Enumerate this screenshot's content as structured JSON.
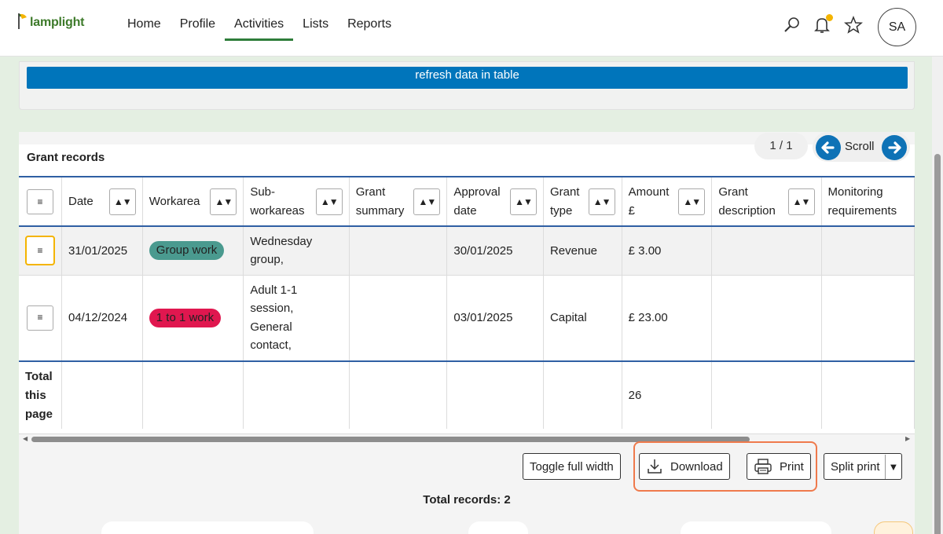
{
  "app": {
    "logo_text": "lamplight"
  },
  "nav": {
    "items": [
      "Home",
      "Profile",
      "Activities",
      "Lists",
      "Reports"
    ],
    "active_index": 2
  },
  "header_icons": [
    "search-icon",
    "bell-icon",
    "star-icon"
  ],
  "user": {
    "initials": "SA"
  },
  "refresh": {
    "label": "refresh data in table"
  },
  "table": {
    "title": "Grant records",
    "pager": "1 / 1",
    "scroll_label": "Scroll",
    "columns": [
      {
        "lines": [
          "Date"
        ]
      },
      {
        "lines": [
          "Workarea"
        ]
      },
      {
        "lines": [
          "Sub-",
          "workareas"
        ]
      },
      {
        "lines": [
          "Grant",
          "summary"
        ]
      },
      {
        "lines": [
          "Approval",
          "date"
        ]
      },
      {
        "lines": [
          "Grant",
          "type"
        ]
      },
      {
        "lines": [
          "Amount",
          "£"
        ]
      },
      {
        "lines": [
          "Grant",
          "description"
        ]
      },
      {
        "lines": [
          "Monitoring",
          "requirements"
        ]
      }
    ],
    "rows": [
      {
        "date": "31/01/2025",
        "workarea": "Group work",
        "workarea_color": "#4a9a8f",
        "subworkareas": [
          "Wednesday",
          "group,"
        ],
        "summary": "",
        "approval_date": "30/01/2025",
        "grant_type": "Revenue",
        "amount": "£ 3.00",
        "description": "",
        "monitoring": ""
      },
      {
        "date": "04/12/2024",
        "workarea": "1 to 1 work",
        "workarea_color": "#e0174f",
        "subworkareas": [
          "Adult 1-1",
          "session,",
          "General",
          "contact,"
        ],
        "summary": "",
        "approval_date": "03/01/2025",
        "grant_type": "Capital",
        "amount": "£ 23.00",
        "description": "",
        "monitoring": ""
      }
    ],
    "total": {
      "label_lines": [
        "Total",
        "this",
        "page"
      ],
      "amount": "26"
    },
    "sort_glyph": "▲▼",
    "menu_glyph": "≡"
  },
  "toolbar": {
    "toggle": "Toggle full width",
    "download": "Download",
    "print": "Print",
    "split_print": "Split print",
    "split_arrow": "▼"
  },
  "total_records": "Total records: 2",
  "colors": {
    "accent": "#0075bb",
    "nav_active": "#2e7d3a",
    "highlight": "#ef7a4c"
  }
}
